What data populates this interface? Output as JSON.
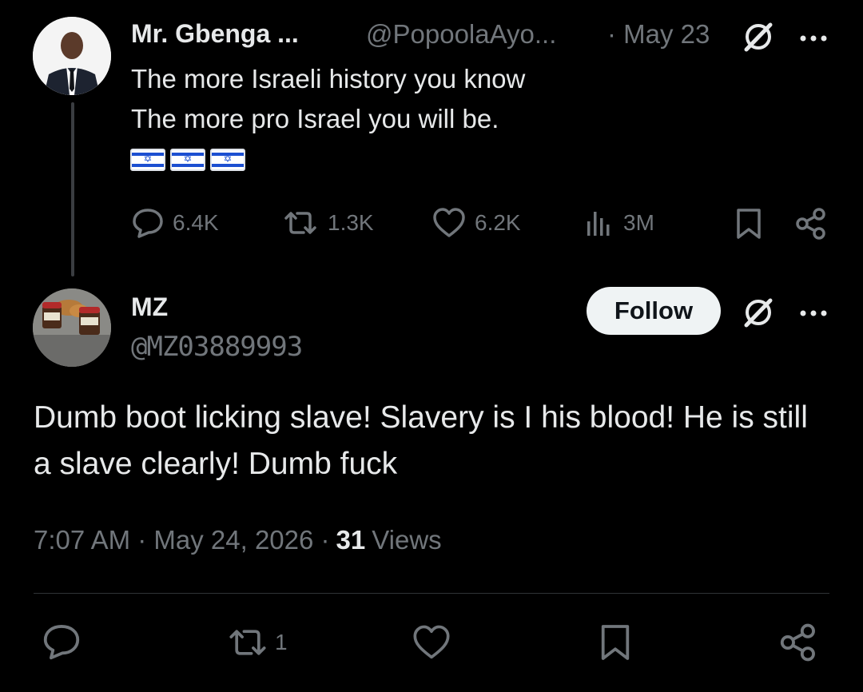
{
  "parent_tweet": {
    "author_name": "Mr. Gbenga ...",
    "handle": "@PopoolaAyo...",
    "date": "· May 23",
    "text_line1": "The more Israeli history you know",
    "text_line2": "The more pro Israel you will be.",
    "flag_count": 3,
    "stats": {
      "replies": "6.4K",
      "retweets": "1.3K",
      "likes": "6.2K",
      "views": "3M"
    }
  },
  "reply_tweet": {
    "author_name": "MZ",
    "handle": "@MZ03889993",
    "follow_label": "Follow",
    "text": "Dumb boot licking slave! Slavery is I his blood! He is still a slave clearly! Dumb fuck",
    "timestamp": "7:07 AM · May 24, 2026 ·",
    "views_count": "31",
    "views_label": "Views",
    "retweet_count": "1"
  },
  "icons": {
    "reply": "reply-icon",
    "retweet": "retweet-icon",
    "like": "heart-icon",
    "views": "views-icon",
    "bookmark": "bookmark-icon",
    "share": "share-icon",
    "grok": "grok-icon",
    "more": "more-icon"
  },
  "colors": {
    "background": "#000000",
    "text": "#e7e9ea",
    "muted": "#71767b",
    "follow_button_bg": "#eff3f4"
  }
}
